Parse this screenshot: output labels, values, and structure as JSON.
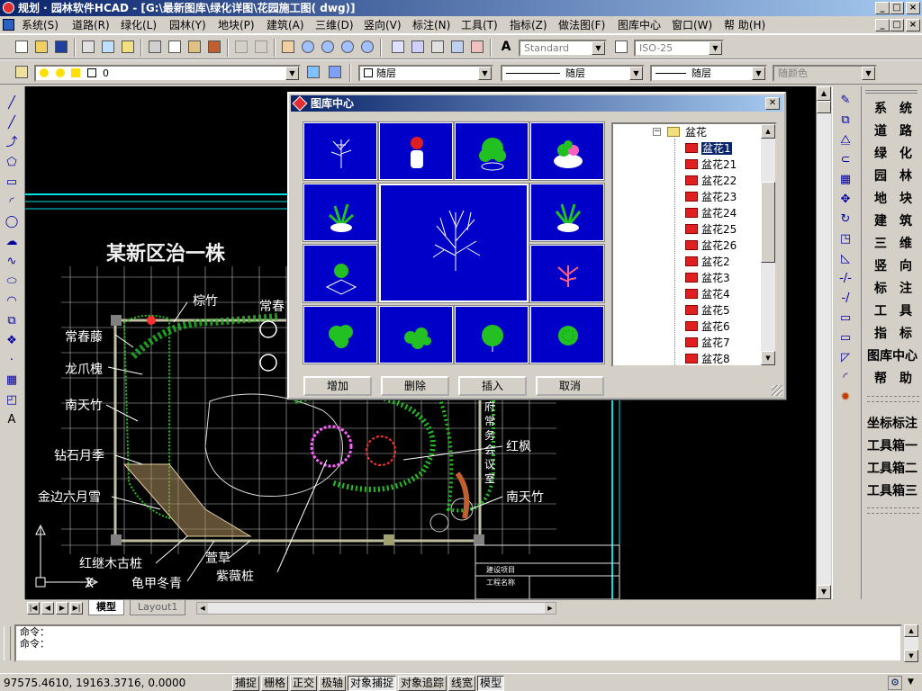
{
  "window": {
    "title": "规划 · 园林软件HCAD   - [G:\\最新图库\\绿化详图\\花园施工图( dwg)]",
    "controls": [
      "_",
      "□",
      "×"
    ]
  },
  "menu": [
    "系统(S)",
    "道路(R)",
    "绿化(L)",
    "园林(Y)",
    "地块(P)",
    "建筑(A)",
    "三维(D)",
    "竖向(V)",
    "标注(N)",
    "工具(T)",
    "指标(Z)",
    "做法图(F)",
    "图库中心",
    "窗口(W)",
    "帮 助(H)"
  ],
  "toolbar": {
    "text_style": "Standard",
    "dim_style": "ISO-25",
    "layer": "0",
    "color": "随层",
    "linetype": "随层",
    "lineweight": "随层",
    "plot_style": "随颜色"
  },
  "right_menu": {
    "items": [
      "系统",
      "道路",
      "绿化",
      "园林",
      "地块",
      "建筑",
      "三维",
      "竖向",
      "标注",
      "工具",
      "指标",
      "图库中心",
      "帮助"
    ],
    "items2": [
      "坐标标注",
      "工具箱一",
      "工具箱二",
      "工具箱三"
    ]
  },
  "drawing": {
    "title": "某新区治一株",
    "labels": {
      "zonglv": "棕竹",
      "changchun_top": "常春",
      "changchunteng": "常春藤",
      "longzhuahuai": "龙爪槐",
      "nantianzhu_left": "南天竹",
      "zuanshi": "钻石月季",
      "jinbian": "金边六月雪",
      "hongjimu": "红继木古桩",
      "guijia": "龟甲冬青",
      "xuancao": "萱草",
      "ziwei": "紫薇桩",
      "hongfeng": "红枫",
      "nantianzhu_right": "南天竹",
      "fuchangwu": "府常务会议室",
      "x_axis": "X"
    },
    "title_block": [
      "建设项目",
      "工程名称"
    ]
  },
  "layout_tabs": [
    "模型",
    "Layout1"
  ],
  "command": {
    "lines": [
      "命令：",
      "命令："
    ]
  },
  "status": {
    "coords": "97575.4610,  19163.3716,  0.0000",
    "buttons": [
      "捕捉",
      "栅格",
      "正交",
      "极轴",
      "对象捕捉",
      "对象追踪",
      "线宽",
      "模型"
    ],
    "active": [
      "对象捕捉",
      "模型"
    ]
  },
  "dialog": {
    "title": "图库中心",
    "tree_folder": "盆花",
    "tree_items": [
      "盆花1",
      "盆花21",
      "盆花22",
      "盆花23",
      "盆花24",
      "盆花25",
      "盆花26",
      "盆花2",
      "盆花3",
      "盆花4",
      "盆花5",
      "盆花6",
      "盆花7",
      "盆花8"
    ],
    "selected": "盆花1",
    "buttons": [
      "增加",
      "删除",
      "插入",
      "取消"
    ]
  },
  "colors": {
    "canvas_bg": "#000000",
    "thumb_bg": "#0000c8",
    "plant_green": "#22c022",
    "grid_white": "#e0e0e0",
    "cyan": "#00e0e0"
  }
}
